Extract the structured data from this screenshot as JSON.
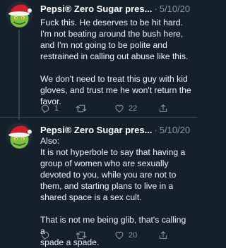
{
  "tweets": [
    {
      "author": "Pepsi® Zero Sugar pres...",
      "separator": "·",
      "date": "5/10/20",
      "text": "Fuck this. He deserves to be hit hard.\nI'm not beating around the bush here,\nand I'm not going to be polite and\nrestrained in calling out abuse like this.\n\nWe don't need to treat this guy with kid\ngloves, and trust me he won't return the\nfavor.",
      "reply_count": "1",
      "retweet_count": "",
      "like_count": "22"
    },
    {
      "author": "Pepsi® Zero Sugar pres...",
      "separator": "·",
      "date": "5/10/20",
      "text": "Also:\nIt is not hyperbole to say that having a\ngroup of women who are sexually\ndevoted to you, while you are not to\nthem, and starting plans to live in a\nshared space is a sex cult.\n\nThat is not me being glib, that's calling a\nspade a spade.",
      "reply_count": "",
      "retweet_count": "",
      "like_count": "20"
    }
  ],
  "icons": {
    "avatar": "grinch-in-santa-hat-avatar",
    "reply": "reply-icon",
    "retweet": "retweet-icon",
    "like": "heart-icon",
    "share": "share-icon"
  },
  "colors": {
    "background": "#15202b",
    "text": "#f0f3f5",
    "secondary_text": "#8b98a5",
    "divider": "#38444d"
  }
}
